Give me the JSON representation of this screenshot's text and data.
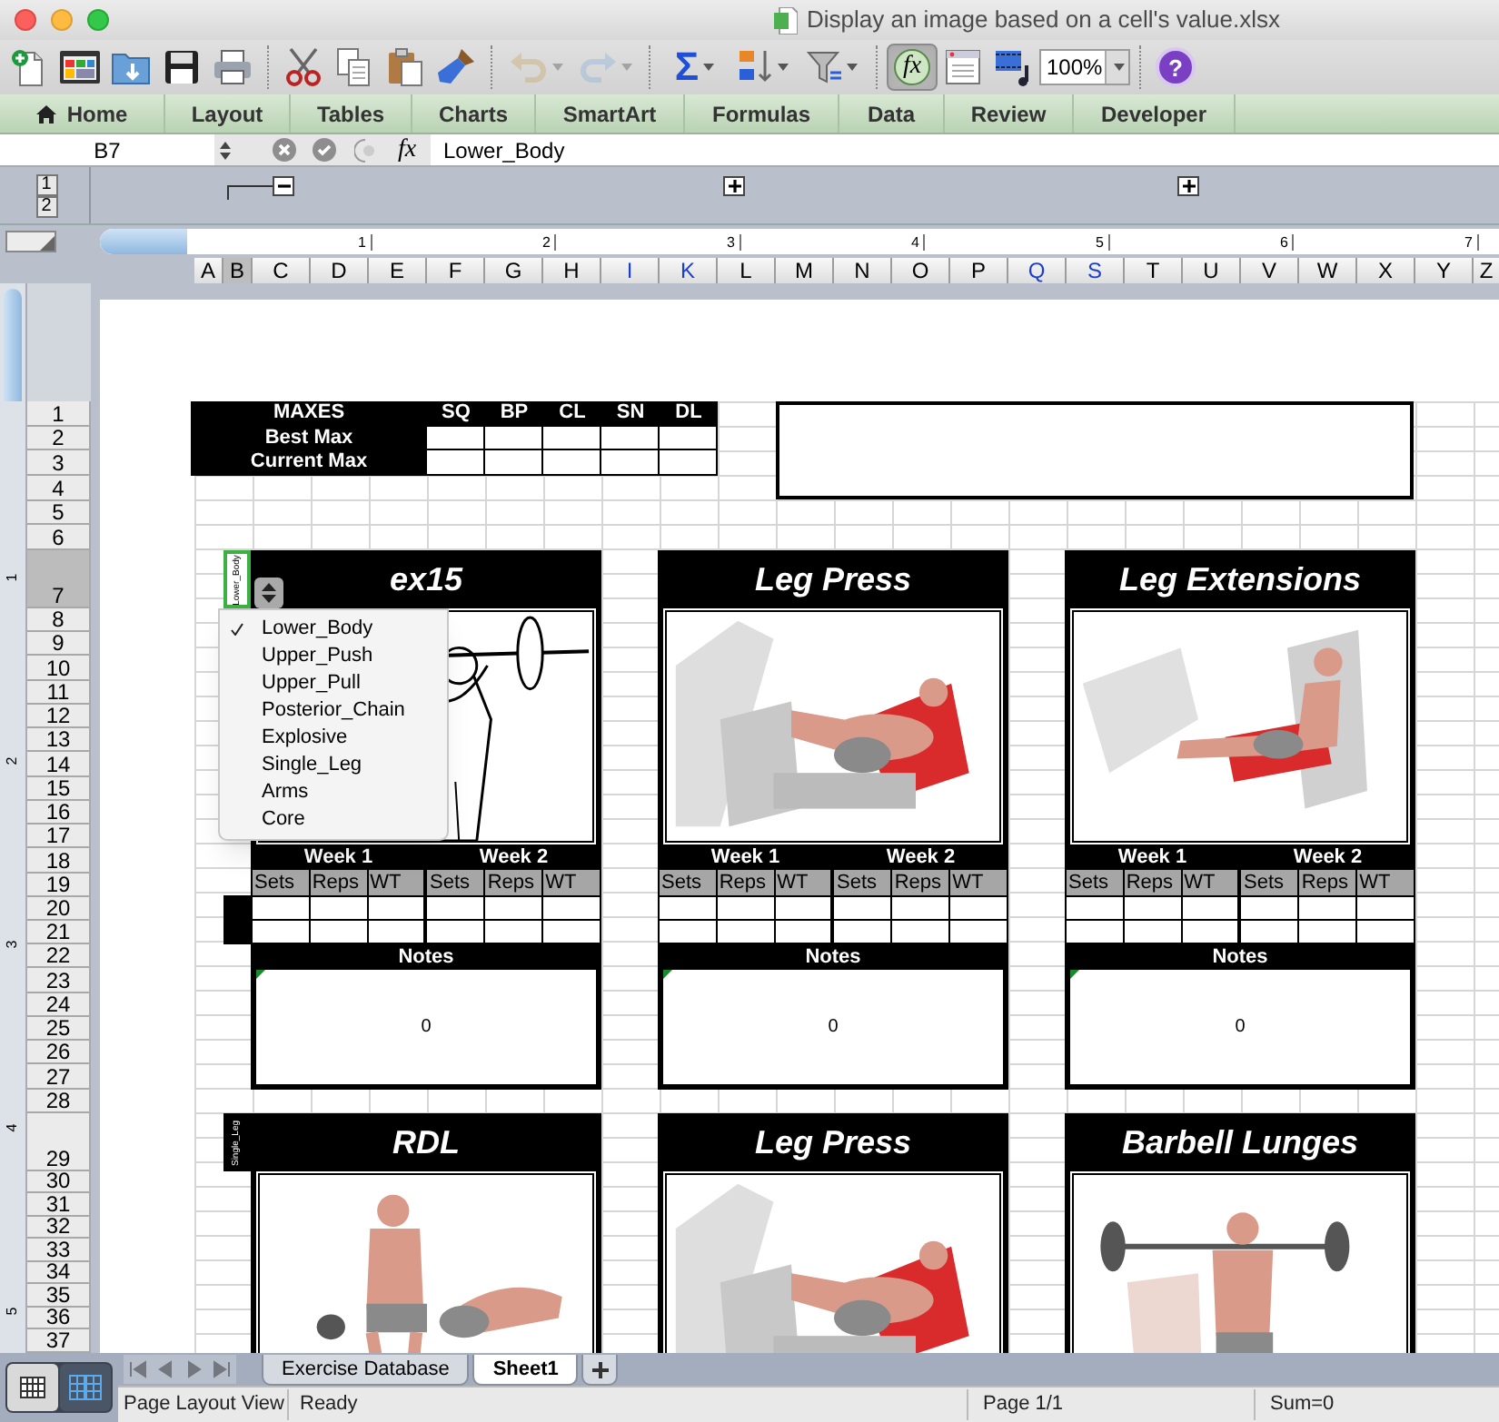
{
  "window": {
    "title": "Display an image based on a cell's value.xlsx"
  },
  "toolbar": {
    "groups": [
      [
        {
          "kind": "new",
          "disabled": false,
          "on": false,
          "caret": false
        },
        {
          "kind": "gallery",
          "disabled": false,
          "on": false,
          "caret": false
        },
        {
          "kind": "open",
          "disabled": false,
          "on": false,
          "caret": false
        },
        {
          "kind": "save",
          "disabled": false,
          "on": false,
          "caret": false
        },
        {
          "kind": "print",
          "disabled": false,
          "on": false,
          "caret": false
        }
      ],
      [
        {
          "kind": "cut",
          "disabled": false,
          "on": false,
          "caret": false
        },
        {
          "kind": "copy",
          "disabled": false,
          "on": false,
          "caret": false
        },
        {
          "kind": "paste",
          "disabled": false,
          "on": false,
          "caret": false
        },
        {
          "kind": "brush",
          "disabled": false,
          "on": false,
          "caret": false
        }
      ],
      [
        {
          "kind": "undo",
          "disabled": true,
          "on": false,
          "caret": true
        },
        {
          "kind": "redo",
          "disabled": true,
          "on": false,
          "caret": true
        }
      ],
      [
        {
          "kind": "sum",
          "label": "Σ",
          "disabled": false,
          "on": false,
          "caret": true
        },
        {
          "kind": "sort",
          "disabled": false,
          "on": false,
          "caret": true
        },
        {
          "kind": "filter",
          "disabled": false,
          "on": false,
          "caret": true
        }
      ],
      [
        {
          "kind": "function",
          "label": "fx",
          "disabled": false,
          "on": true,
          "caret": false
        },
        {
          "kind": "toolbox",
          "disabled": false,
          "on": false,
          "caret": false
        },
        {
          "kind": "media",
          "disabled": false,
          "on": false,
          "caret": false
        },
        {
          "kind": "zoom",
          "value": "100%",
          "disabled": false,
          "on": false,
          "caret": true
        }
      ],
      [
        {
          "kind": "help",
          "label": "?",
          "disabled": false,
          "on": false,
          "caret": false
        }
      ]
    ]
  },
  "ribbon_tabs": [
    {
      "label": "Home",
      "kind": "home"
    },
    {
      "label": "Layout",
      "kind": "text"
    },
    {
      "label": "Tables",
      "kind": "text"
    },
    {
      "label": "Charts",
      "kind": "text"
    },
    {
      "label": "SmartArt",
      "kind": "text"
    },
    {
      "label": "Formulas",
      "kind": "text"
    },
    {
      "label": "Data",
      "kind": "text"
    },
    {
      "label": "Review",
      "kind": "text"
    },
    {
      "label": "Developer",
      "kind": "text"
    }
  ],
  "formula_bar": {
    "name_box": "B7",
    "fx_label": "fx",
    "value": "Lower_Body"
  },
  "outline": {
    "levels": [
      "1",
      "2"
    ],
    "groups": [
      {
        "expanded": true
      },
      {
        "expanded": false
      },
      {
        "expanded": false
      }
    ]
  },
  "ruler": {
    "h_marks": [
      "1",
      "2",
      "3",
      "4",
      "5",
      "6",
      "7"
    ],
    "v_marks": [
      "1",
      "2",
      "3",
      "4",
      "5"
    ]
  },
  "columns": [
    {
      "label": "A",
      "selected": false,
      "color": "#000000"
    },
    {
      "label": "B",
      "selected": true,
      "color": "#000000"
    },
    {
      "label": "C",
      "selected": false,
      "color": "#000000"
    },
    {
      "label": "D",
      "selected": false,
      "color": "#000000"
    },
    {
      "label": "E",
      "selected": false,
      "color": "#000000"
    },
    {
      "label": "F",
      "selected": false,
      "color": "#000000"
    },
    {
      "label": "G",
      "selected": false,
      "color": "#000000"
    },
    {
      "label": "H",
      "selected": false,
      "color": "#000000"
    },
    {
      "label": "I",
      "selected": false,
      "color": "#1a3fcc"
    },
    {
      "label": "K",
      "selected": false,
      "color": "#1a3fcc"
    },
    {
      "label": "L",
      "selected": false,
      "color": "#000000"
    },
    {
      "label": "M",
      "selected": false,
      "color": "#000000"
    },
    {
      "label": "N",
      "selected": false,
      "color": "#000000"
    },
    {
      "label": "O",
      "selected": false,
      "color": "#000000"
    },
    {
      "label": "P",
      "selected": false,
      "color": "#000000"
    },
    {
      "label": "Q",
      "selected": false,
      "color": "#1a3fcc"
    },
    {
      "label": "S",
      "selected": false,
      "color": "#1a3fcc"
    },
    {
      "label": "T",
      "selected": false,
      "color": "#000000"
    },
    {
      "label": "U",
      "selected": false,
      "color": "#000000"
    },
    {
      "label": "V",
      "selected": false,
      "color": "#000000"
    },
    {
      "label": "W",
      "selected": false,
      "color": "#000000"
    },
    {
      "label": "X",
      "selected": false,
      "color": "#000000"
    },
    {
      "label": "Y",
      "selected": false,
      "color": "#000000"
    },
    {
      "label": "Z",
      "selected": false,
      "color": "#000000"
    }
  ],
  "rows": [
    {
      "label": "1",
      "selected": false
    },
    {
      "label": "2",
      "selected": false
    },
    {
      "label": "3",
      "selected": false
    },
    {
      "label": "4",
      "selected": false
    },
    {
      "label": "5",
      "selected": false
    },
    {
      "label": "6",
      "selected": false
    },
    {
      "label": "7",
      "selected": true
    },
    {
      "label": "8",
      "selected": false
    },
    {
      "label": "9",
      "selected": false
    },
    {
      "label": "10",
      "selected": false
    },
    {
      "label": "11",
      "selected": false
    },
    {
      "label": "12",
      "selected": false
    },
    {
      "label": "13",
      "selected": false
    },
    {
      "label": "14",
      "selected": false
    },
    {
      "label": "15",
      "selected": false
    },
    {
      "label": "16",
      "selected": false
    },
    {
      "label": "17",
      "selected": false
    },
    {
      "label": "18",
      "selected": false
    },
    {
      "label": "19",
      "selected": false
    },
    {
      "label": "20",
      "selected": false
    },
    {
      "label": "21",
      "selected": false
    },
    {
      "label": "22",
      "selected": false
    },
    {
      "label": "23",
      "selected": false
    },
    {
      "label": "24",
      "selected": false
    },
    {
      "label": "25",
      "selected": false
    },
    {
      "label": "26",
      "selected": false
    },
    {
      "label": "27",
      "selected": false
    },
    {
      "label": "28",
      "selected": false
    },
    {
      "label": "29",
      "selected": false
    },
    {
      "label": "30",
      "selected": false
    },
    {
      "label": "31",
      "selected": false
    },
    {
      "label": "32",
      "selected": false
    },
    {
      "label": "33",
      "selected": false
    },
    {
      "label": "34",
      "selected": false
    },
    {
      "label": "35",
      "selected": false
    },
    {
      "label": "36",
      "selected": false
    },
    {
      "label": "37",
      "selected": false
    }
  ],
  "maxes_table": {
    "header": "MAXES",
    "lifts": [
      "SQ",
      "BP",
      "CL",
      "SN",
      "DL"
    ],
    "rows": [
      "Best Max",
      "Current Max"
    ]
  },
  "card_rows": [
    [
      {
        "category": "Lower_Body",
        "selected": true,
        "title": "ex15",
        "weeks": [
          "Week 1",
          "Week 2"
        ],
        "columns": [
          "Sets",
          "Reps",
          "WT",
          "Sets",
          "Reps",
          "WT"
        ],
        "notes_label": "Notes",
        "notes": "0"
      },
      {
        "selected": false,
        "title": "Leg Press",
        "weeks": [
          "Week 1",
          "Week 2"
        ],
        "columns": [
          "Sets",
          "Reps",
          "WT",
          "Sets",
          "Reps",
          "WT"
        ],
        "notes_label": "Notes",
        "notes": "0"
      },
      {
        "selected": false,
        "title": "Leg Extensions",
        "weeks": [
          "Week 1",
          "Week 2"
        ],
        "columns": [
          "Sets",
          "Reps",
          "WT",
          "Sets",
          "Reps",
          "WT"
        ],
        "notes_label": "Notes",
        "notes": "0"
      }
    ],
    [
      {
        "category": "Single_Leg",
        "selected": false,
        "title": "RDL"
      },
      {
        "selected": false,
        "title": "Leg Press"
      },
      {
        "selected": false,
        "title": "Barbell Lunges"
      }
    ]
  ],
  "dropdown": {
    "items": [
      {
        "label": "Lower_Body",
        "selected": true
      },
      {
        "label": "Upper_Push",
        "selected": false
      },
      {
        "label": "Upper_Pull",
        "selected": false
      },
      {
        "label": "Posterior_Chain",
        "selected": false
      },
      {
        "label": "Explosive",
        "selected": false
      },
      {
        "label": "Single_Leg",
        "selected": false
      },
      {
        "label": "Arms",
        "selected": false
      },
      {
        "label": "Core",
        "selected": false
      }
    ]
  },
  "view_buttons": [
    {
      "kind": "normal",
      "selected": false
    },
    {
      "kind": "page_layout",
      "selected": true
    }
  ],
  "sheet_tabs": [
    {
      "label": "Exercise Database",
      "selected": false
    },
    {
      "label": "Sheet1",
      "selected": true
    }
  ],
  "status_bar": {
    "view": "Page Layout View",
    "state": "Ready",
    "page": "Page 1/1",
    "sum": "Sum=0"
  }
}
